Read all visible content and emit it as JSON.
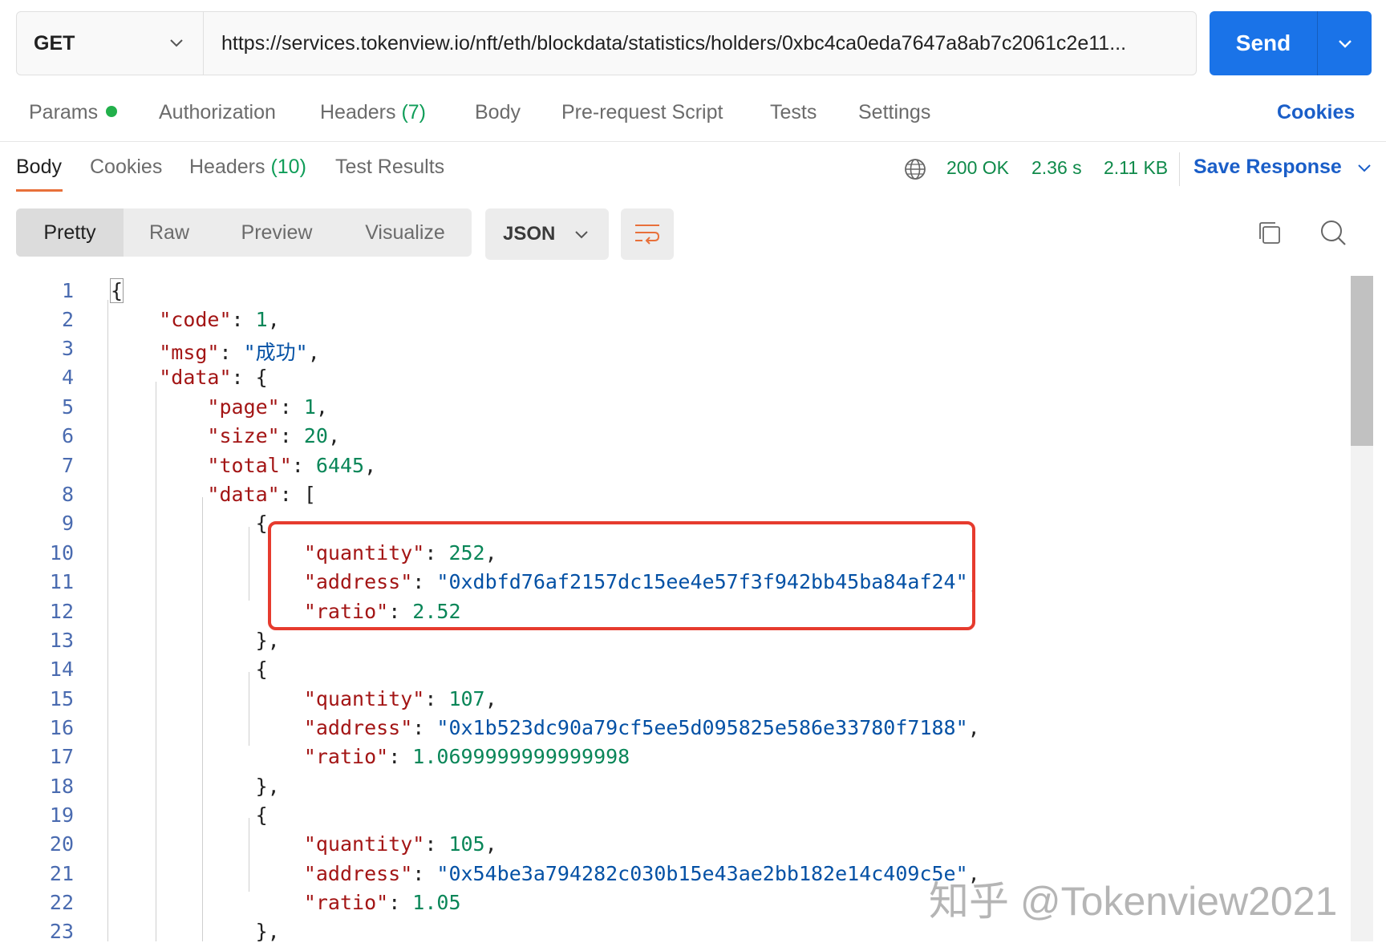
{
  "request": {
    "method": "GET",
    "url": "https://services.tokenview.io/nft/eth/blockdata/statistics/holders/0xbc4ca0eda7647a8ab7c2061c2e11...",
    "send_label": "Send"
  },
  "request_tabs": {
    "params": "Params",
    "authorization": "Authorization",
    "headers": "Headers",
    "headers_count": "(7)",
    "body": "Body",
    "prerequest": "Pre-request Script",
    "tests": "Tests",
    "settings": "Settings",
    "cookies": "Cookies"
  },
  "response_tabs": {
    "body": "Body",
    "cookies": "Cookies",
    "headers": "Headers",
    "headers_count": "(10)",
    "test_results": "Test Results"
  },
  "response_status": {
    "status": "200 OK",
    "time": "2.36 s",
    "size": "2.11 KB",
    "save_label": "Save Response"
  },
  "view_modes": [
    "Pretty",
    "Raw",
    "Preview",
    "Visualize"
  ],
  "format": "JSON",
  "code": {
    "line_numbers": [
      "1",
      "2",
      "3",
      "4",
      "5",
      "6",
      "7",
      "8",
      "9",
      "10",
      "11",
      "12",
      "13",
      "14",
      "15",
      "16",
      "17",
      "18",
      "19",
      "20",
      "21",
      "22",
      "23"
    ],
    "l1": "{",
    "code_key": "\"code\"",
    "code_val": "1",
    "msg_key": "\"msg\"",
    "msg_val": "\"成功\"",
    "data_key": "\"data\"",
    "page_key": "\"page\"",
    "page_val": "1",
    "size_key": "\"size\"",
    "size_val": "20",
    "total_key": "\"total\"",
    "total_val": "6445",
    "data2_key": "\"data\"",
    "quantity_key": "\"quantity\"",
    "address_key": "\"address\"",
    "ratio_key": "\"ratio\"",
    "holders": [
      {
        "quantity": "252",
        "address": "\"0xdbfd76af2157dc15ee4e57f3f942bb45ba84af24\"",
        "ratio": "2.52"
      },
      {
        "quantity": "107",
        "address": "\"0x1b523dc90a79cf5ee5d095825e586e33780f7188\"",
        "ratio": "1.0699999999999998"
      },
      {
        "quantity": "105",
        "address": "\"0x54be3a794282c030b15e43ae2bb182e14c409c5e\"",
        "ratio": "1.05"
      }
    ]
  },
  "watermark": "知乎 @Tokenview2021",
  "colors": {
    "accent": "#1a73e8",
    "highlight_border": "#e63b2e",
    "active_tab_underline": "#e8703a"
  }
}
